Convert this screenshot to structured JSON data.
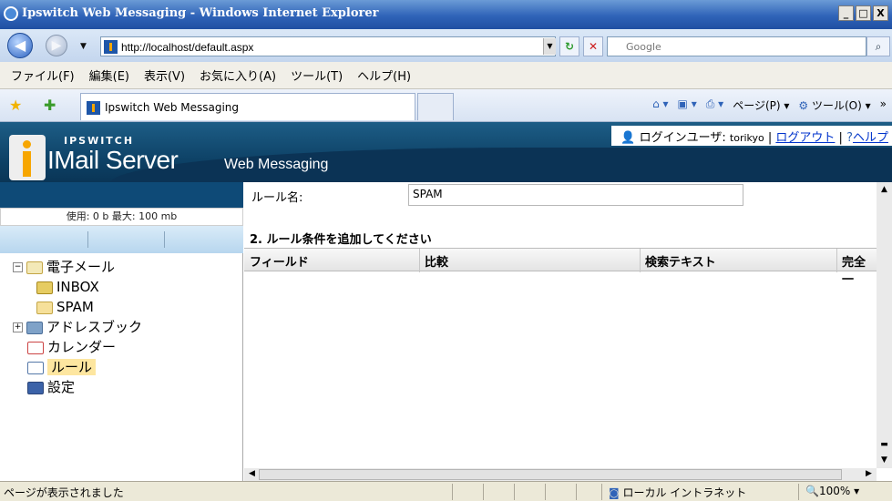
{
  "window": {
    "title": "Ipswitch Web Messaging - Windows Internet Explorer",
    "min": "_",
    "max": "□",
    "close": "X"
  },
  "address": {
    "url": "http://localhost/default.aspx",
    "search_placeholder": "Google"
  },
  "menu": [
    "ファイル(F)",
    "編集(E)",
    "表示(V)",
    "お気に入り(A)",
    "ツール(T)",
    "ヘルプ(H)"
  ],
  "tab": {
    "label": "Ipswitch Web Messaging"
  },
  "commandbar": {
    "page": "ページ(P)",
    "tools": "ツール(O)"
  },
  "banner": {
    "brand": "IPSWITCH",
    "product": "IMail Server",
    "subtitle": "Web Messaging",
    "login_label": "ログインユーザ:",
    "username": "torikyo",
    "logout": "ログアウト",
    "help": "ヘルプ"
  },
  "sidebar": {
    "usage": "使用: 0 b 最大: 100 mb",
    "items": [
      {
        "label": "電子メール"
      },
      {
        "label": "INBOX"
      },
      {
        "label": "SPAM"
      },
      {
        "label": "アドレスブック"
      },
      {
        "label": "カレンダー"
      },
      {
        "label": "ルール"
      },
      {
        "label": "設定"
      }
    ]
  },
  "main": {
    "rule_name_label": "ルール名:",
    "rule_name_value": "SPAM",
    "section_title": "2. ルール条件を追加してください",
    "columns": [
      "フィールド",
      "比較",
      "検索テキスト",
      "完全一"
    ]
  },
  "status": {
    "text": "ページが表示されました",
    "zone": "ローカル イントラネット",
    "zoom": "100%"
  },
  "colors": {
    "banner": "#0c3f63",
    "titlebar": "#2f63b8",
    "link": "#0033cc",
    "selected": "#fde6a0"
  }
}
